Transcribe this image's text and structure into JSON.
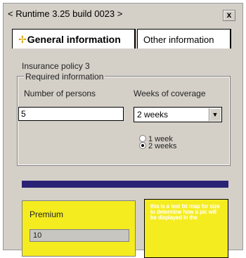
{
  "window": {
    "title": "< Runtime 3.25 build 0023 >",
    "close_label": "x"
  },
  "tabs": [
    {
      "label": "General information",
      "icon": "puzzle-icon",
      "active": true
    },
    {
      "label": "Other information",
      "active": false
    }
  ],
  "general": {
    "policy_label": "Insurance policy 3",
    "required_group": {
      "legend": "Required information",
      "persons_label": "Number of persons",
      "persons_value": "5",
      "weeks_label": "Weeks of coverage",
      "weeks_selected": "2 weeks",
      "radios": [
        {
          "label": "1 week",
          "checked": false
        },
        {
          "label": "2 weeks",
          "checked": true
        }
      ]
    },
    "premium_label": "Premium",
    "premium_value": "10",
    "bitmap_text": "this is a test bit map for size to determine how a pic will be displayed in the"
  },
  "colors": {
    "window_bg": "#d4d0c8",
    "divider": "#2a2375",
    "premium_bg": "#f5ec1f"
  }
}
